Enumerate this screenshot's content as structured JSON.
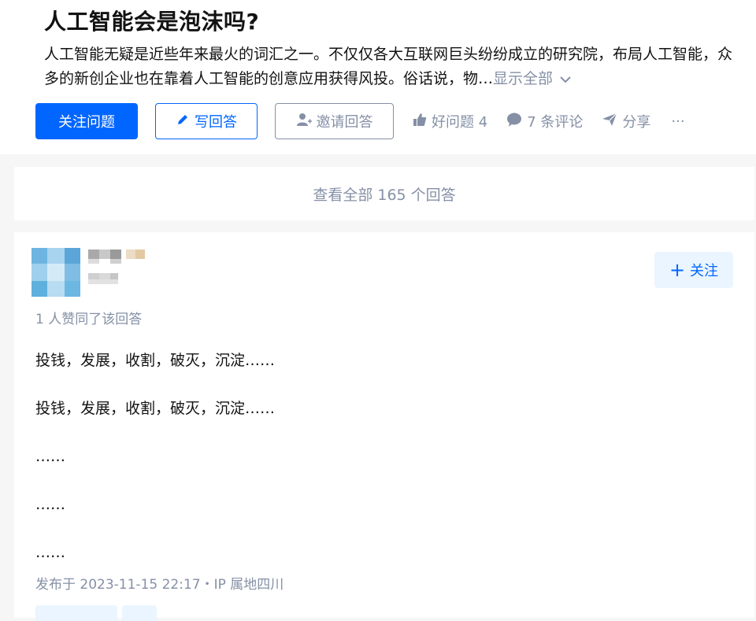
{
  "question": {
    "title": "人工智能会是泡沫吗?",
    "description": "人工智能无疑是近些年来最火的词汇之一。不仅仅各大互联网巨头纷纷成立的研究院，布局人工智能，众多的新创企业也在靠着人工智能的创意应用获得风投。俗话说，物…",
    "show_all_label": "显示全部"
  },
  "actions": {
    "follow_question": "关注问题",
    "write_answer": "写回答",
    "invite_answer": "邀请回答",
    "good_question": "好问题 4",
    "comments": "7 条评论",
    "share": "分享",
    "more": "···"
  },
  "view_all_answers": "查看全部 165 个回答",
  "answer": {
    "follow_label": "关注",
    "upvote_info": "1 人赞同了该回答",
    "paragraphs": [
      "投钱，发展，收割，破灭，沉淀……",
      "投钱，发展，收割，破灭，沉淀……",
      "……",
      "……",
      "……"
    ],
    "publish_info": "发布于 2023-11-15 22:17・IP 属地四川"
  },
  "colors": {
    "primary": "#0066ff",
    "muted": "#8590a6",
    "follow_bg": "#ebf5ff",
    "page_bg": "#f6f6f6"
  },
  "icons": [
    "pencil-icon",
    "invite-user-icon",
    "thumbs-up-icon",
    "comment-bubble-icon",
    "paper-plane-icon",
    "chevron-down-icon",
    "plus-icon"
  ]
}
